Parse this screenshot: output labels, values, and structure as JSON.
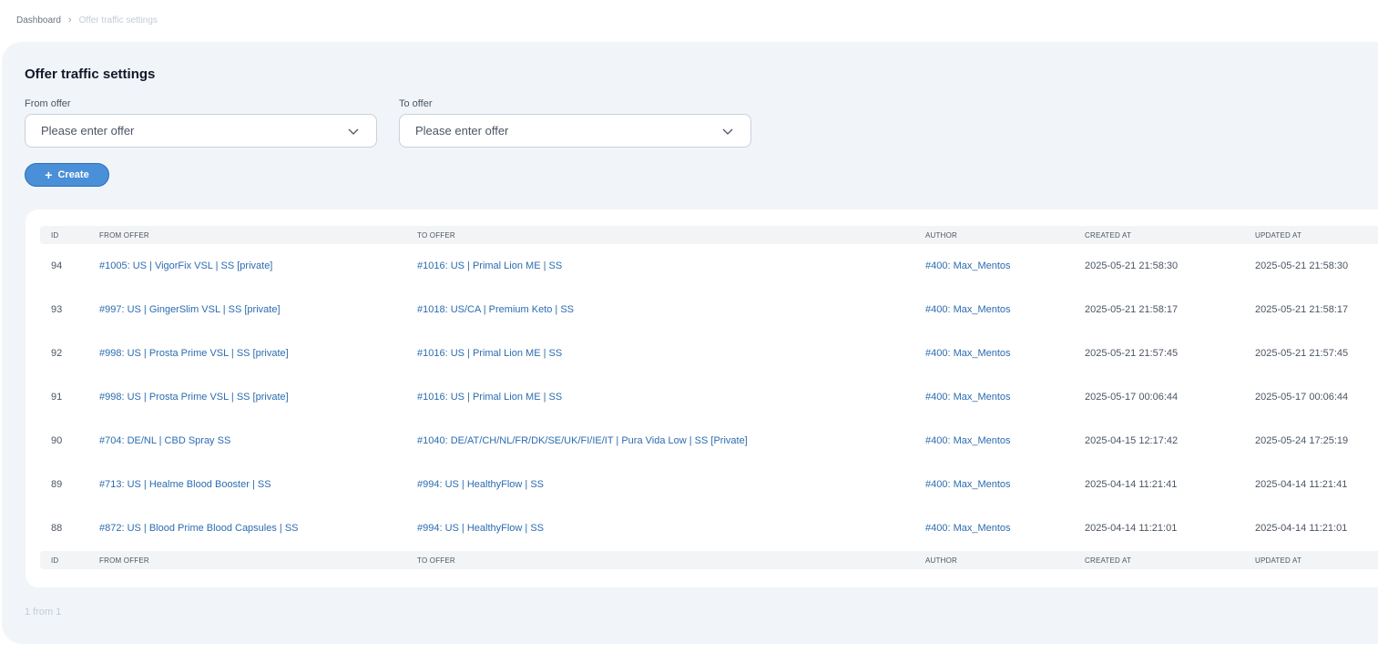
{
  "breadcrumb": {
    "home": "Dashboard",
    "current": "Offer traffic settings"
  },
  "page": {
    "title": "Offer traffic settings"
  },
  "filters": {
    "from": {
      "label": "From offer",
      "placeholder": "Please enter offer"
    },
    "to": {
      "label": "To offer",
      "placeholder": "Please enter offer"
    }
  },
  "actions": {
    "create_label": "Create"
  },
  "table": {
    "headers": {
      "id": "ID",
      "from": "FROM OFFER",
      "to": "TO OFFER",
      "author": "AUTHOR",
      "created": "CREATED AT",
      "updated": "UPDATED AT"
    },
    "rows": [
      {
        "id": "94",
        "from": "#1005: US | VigorFix VSL | SS [private]",
        "to": "#1016: US | Primal Lion ME | SS",
        "author": "#400: Max_Mentos",
        "created": "2025-05-21 21:58:30",
        "updated": "2025-05-21 21:58:30"
      },
      {
        "id": "93",
        "from": "#997: US | GingerSlim VSL | SS [private]",
        "to": "#1018: US/CA | Premium Keto | SS",
        "author": "#400: Max_Mentos",
        "created": "2025-05-21 21:58:17",
        "updated": "2025-05-21 21:58:17"
      },
      {
        "id": "92",
        "from": "#998: US | Prosta Prime VSL | SS [private]",
        "to": "#1016: US | Primal Lion ME | SS",
        "author": "#400: Max_Mentos",
        "created": "2025-05-21 21:57:45",
        "updated": "2025-05-21 21:57:45"
      },
      {
        "id": "91",
        "from": "#998: US | Prosta Prime VSL | SS [private]",
        "to": "#1016: US | Primal Lion ME | SS",
        "author": "#400: Max_Mentos",
        "created": "2025-05-17 00:06:44",
        "updated": "2025-05-17 00:06:44"
      },
      {
        "id": "90",
        "from": "#704: DE/NL | CBD Spray SS",
        "to": "#1040: DE/AT/CH/NL/FR/DK/SE/UK/FI/IE/IT | Pura Vida Low | SS [Private]",
        "author": "#400: Max_Mentos",
        "created": "2025-04-15 12:17:42",
        "updated": "2025-05-24 17:25:19"
      },
      {
        "id": "89",
        "from": "#713: US | Healme Blood Booster | SS",
        "to": "#994: US | HealthyFlow | SS",
        "author": "#400: Max_Mentos",
        "created": "2025-04-14 11:21:41",
        "updated": "2025-04-14 11:21:41"
      },
      {
        "id": "88",
        "from": "#872: US | Blood Prime Blood Capsules | SS",
        "to": "#994: US | HealthyFlow | SS",
        "author": "#400: Max_Mentos",
        "created": "2025-04-14 11:21:01",
        "updated": "2025-04-14 11:21:01"
      }
    ]
  },
  "pagination": {
    "text": "1 from 1"
  },
  "icons": {
    "breadcrumb_separator": "chevron-right-icon",
    "select": "chevron-down-icon",
    "create": "plus-icon"
  },
  "colors": {
    "accent": "#4a90d9",
    "link": "#2b6cb0",
    "panel": "#f1f5f9"
  }
}
